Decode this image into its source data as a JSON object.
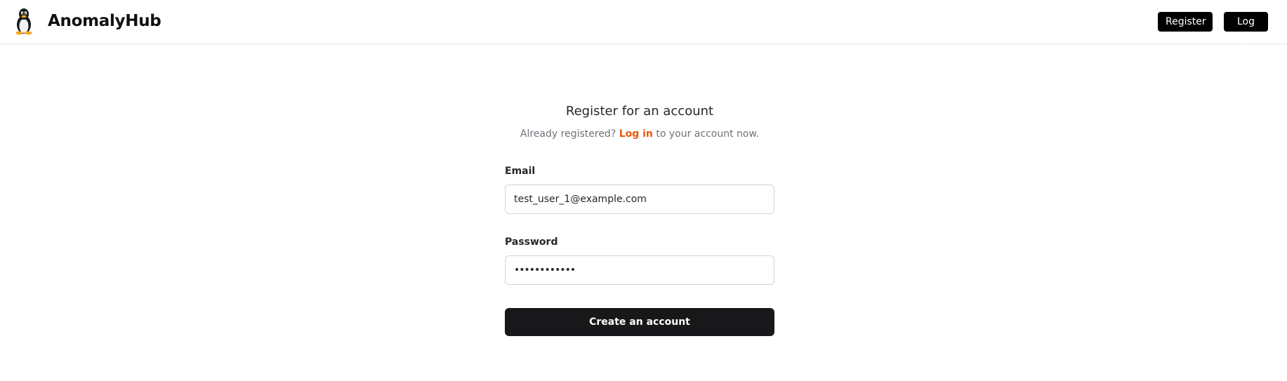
{
  "header": {
    "brand": "AnomalyHub",
    "logo_icon": "penguin-icon",
    "register_label": "Register",
    "login_label": "Log in"
  },
  "form": {
    "title": "Register for an account",
    "subtitle_prefix": "Already registered?",
    "subtitle_link": "Log in",
    "subtitle_suffix": "to your account now.",
    "email_label": "Email",
    "email_value": "test_user_1@example.com",
    "password_label": "Password",
    "password_value": "••••••••••••",
    "submit_label": "Create an account"
  },
  "colors": {
    "accent": "#ea580c",
    "primary_button": "#18181b",
    "nav_button": "#000000"
  }
}
